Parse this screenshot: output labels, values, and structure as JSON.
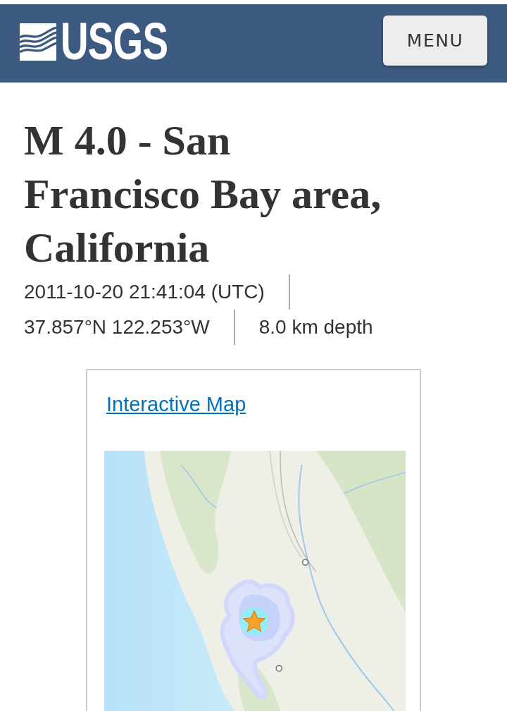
{
  "header": {
    "logo": "USGS",
    "menu_button": "MENU"
  },
  "event": {
    "title": "M 4.0 - San Francisco Bay area, California",
    "details": {
      "time": "2011-10-20 21:41:04 (UTC)",
      "location": "37.857°N 122.253°W",
      "depth": "8.0 km depth"
    }
  },
  "map_card": {
    "link": "Interactive Map"
  }
}
